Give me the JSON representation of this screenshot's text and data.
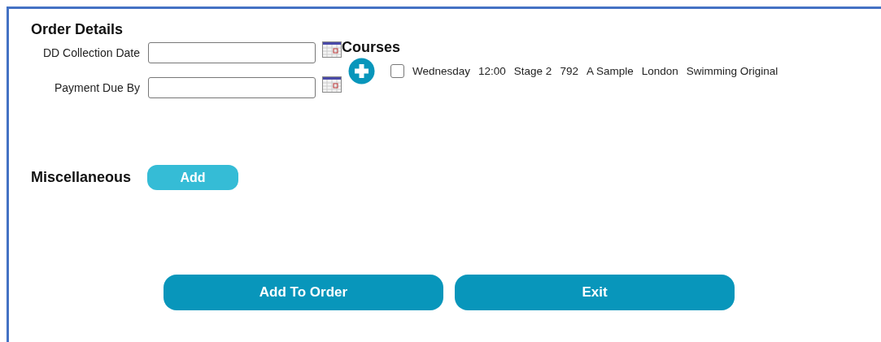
{
  "order_details": {
    "title": "Order Details",
    "fields": [
      {
        "label": "DD Collection Date"
      },
      {
        "label": "Payment Due By"
      }
    ]
  },
  "courses": {
    "title": "Courses",
    "items": [
      {
        "checked": false,
        "parts": [
          "Wednesday",
          "12:00",
          "Stage 2",
          "792",
          "A Sample",
          "London",
          "Swimming Original"
        ]
      }
    ]
  },
  "miscellaneous": {
    "title": "Miscellaneous",
    "button": "Add"
  },
  "buttons": [
    "Add To Order",
    "Exit"
  ]
}
